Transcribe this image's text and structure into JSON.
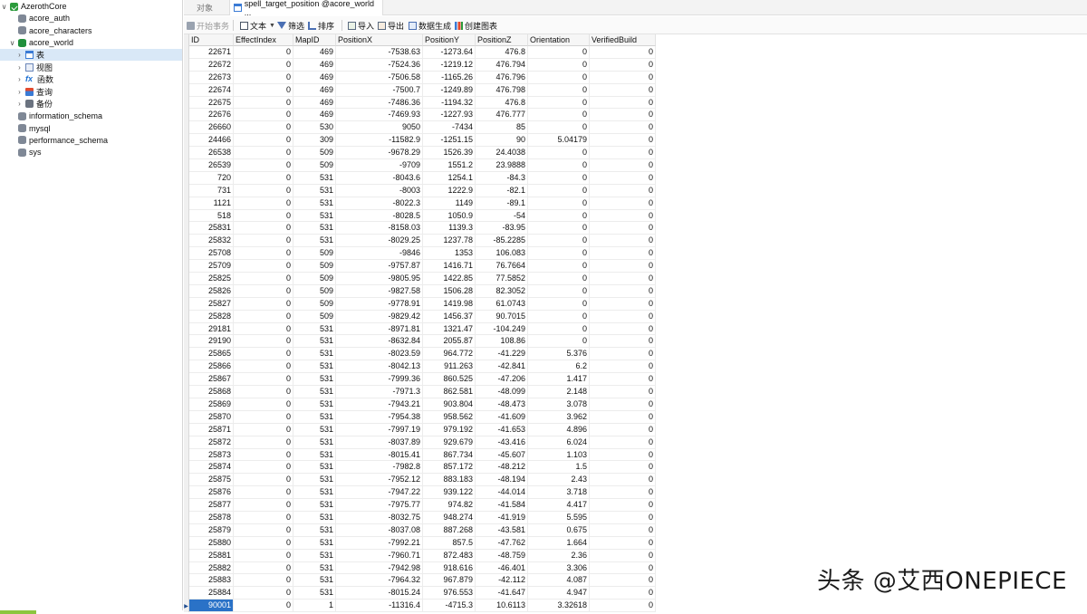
{
  "sidebar": {
    "items": [
      {
        "name": "conn-azerothcore",
        "label": "AzerothCore",
        "icon": "connection-icon",
        "chev": "∨",
        "indent": 0
      },
      {
        "name": "db-acore-auth",
        "label": "acore_auth",
        "icon": "database-icon",
        "chev": "",
        "indent": 1
      },
      {
        "name": "db-acore-characters",
        "label": "acore_characters",
        "icon": "database-icon",
        "chev": "",
        "indent": 1
      },
      {
        "name": "db-acore-world",
        "label": "acore_world",
        "icon": "database-open-icon",
        "chev": "∨",
        "indent": 1
      },
      {
        "name": "node-tables",
        "label": "表",
        "icon": "table-icon",
        "chev": "›",
        "indent": 2,
        "selected": true
      },
      {
        "name": "node-views",
        "label": "视图",
        "icon": "view-icon",
        "chev": "›",
        "indent": 2
      },
      {
        "name": "node-functions",
        "label": "函数",
        "icon": "function-icon",
        "chev": "›",
        "indent": 2
      },
      {
        "name": "node-queries",
        "label": "查询",
        "icon": "query-icon",
        "chev": "›",
        "indent": 2
      },
      {
        "name": "node-backups",
        "label": "备份",
        "icon": "backup-icon",
        "chev": "›",
        "indent": 2
      },
      {
        "name": "db-information-schema",
        "label": "information_schema",
        "icon": "database-icon",
        "chev": "",
        "indent": 1
      },
      {
        "name": "db-mysql",
        "label": "mysql",
        "icon": "database-icon",
        "chev": "",
        "indent": 1
      },
      {
        "name": "db-performance-schema",
        "label": "performance_schema",
        "icon": "database-icon",
        "chev": "",
        "indent": 1
      },
      {
        "name": "db-sys",
        "label": "sys",
        "icon": "database-icon",
        "chev": "",
        "indent": 1
      }
    ]
  },
  "tabs": {
    "objects_label": "对象",
    "active_label": "spell_target_position @acore_world ..."
  },
  "toolbar": {
    "begin_tx": "开始事务",
    "text": "文本",
    "filter": "筛选",
    "sort": "排序",
    "import": "导入",
    "export": "导出",
    "generate": "数据生成",
    "create_chart": "创建图表"
  },
  "table": {
    "columns": [
      "ID",
      "EffectIndex",
      "MapID",
      "PositionX",
      "PositionY",
      "PositionZ",
      "Orientation",
      "VerifiedBuild"
    ],
    "rows": [
      [
        "22671",
        "0",
        "469",
        "-7538.63",
        "-1273.64",
        "476.8",
        "0",
        "0"
      ],
      [
        "22672",
        "0",
        "469",
        "-7524.36",
        "-1219.12",
        "476.794",
        "0",
        "0"
      ],
      [
        "22673",
        "0",
        "469",
        "-7506.58",
        "-1165.26",
        "476.796",
        "0",
        "0"
      ],
      [
        "22674",
        "0",
        "469",
        "-7500.7",
        "-1249.89",
        "476.798",
        "0",
        "0"
      ],
      [
        "22675",
        "0",
        "469",
        "-7486.36",
        "-1194.32",
        "476.8",
        "0",
        "0"
      ],
      [
        "22676",
        "0",
        "469",
        "-7469.93",
        "-1227.93",
        "476.777",
        "0",
        "0"
      ],
      [
        "26660",
        "0",
        "530",
        "9050",
        "-7434",
        "85",
        "0",
        "0"
      ],
      [
        "24466",
        "0",
        "309",
        "-11582.9",
        "-1251.15",
        "90",
        "5.04179",
        "0"
      ],
      [
        "26538",
        "0",
        "509",
        "-9678.29",
        "1526.39",
        "24.4038",
        "0",
        "0"
      ],
      [
        "26539",
        "0",
        "509",
        "-9709",
        "1551.2",
        "23.9888",
        "0",
        "0"
      ],
      [
        "720",
        "0",
        "531",
        "-8043.6",
        "1254.1",
        "-84.3",
        "0",
        "0"
      ],
      [
        "731",
        "0",
        "531",
        "-8003",
        "1222.9",
        "-82.1",
        "0",
        "0"
      ],
      [
        "1121",
        "0",
        "531",
        "-8022.3",
        "1149",
        "-89.1",
        "0",
        "0"
      ],
      [
        "518",
        "0",
        "531",
        "-8028.5",
        "1050.9",
        "-54",
        "0",
        "0"
      ],
      [
        "25831",
        "0",
        "531",
        "-8158.03",
        "1139.3",
        "-83.95",
        "0",
        "0"
      ],
      [
        "25832",
        "0",
        "531",
        "-8029.25",
        "1237.78",
        "-85.2285",
        "0",
        "0"
      ],
      [
        "25708",
        "0",
        "509",
        "-9846",
        "1353",
        "106.083",
        "0",
        "0"
      ],
      [
        "25709",
        "0",
        "509",
        "-9757.87",
        "1416.71",
        "76.7664",
        "0",
        "0"
      ],
      [
        "25825",
        "0",
        "509",
        "-9805.95",
        "1422.85",
        "77.5852",
        "0",
        "0"
      ],
      [
        "25826",
        "0",
        "509",
        "-9827.58",
        "1506.28",
        "82.3052",
        "0",
        "0"
      ],
      [
        "25827",
        "0",
        "509",
        "-9778.91",
        "1419.98",
        "61.0743",
        "0",
        "0"
      ],
      [
        "25828",
        "0",
        "509",
        "-9829.42",
        "1456.37",
        "90.7015",
        "0",
        "0"
      ],
      [
        "29181",
        "0",
        "531",
        "-8971.81",
        "1321.47",
        "-104.249",
        "0",
        "0"
      ],
      [
        "29190",
        "0",
        "531",
        "-8632.84",
        "2055.87",
        "108.86",
        "0",
        "0"
      ],
      [
        "25865",
        "0",
        "531",
        "-8023.59",
        "964.772",
        "-41.229",
        "5.376",
        "0"
      ],
      [
        "25866",
        "0",
        "531",
        "-8042.13",
        "911.263",
        "-42.841",
        "6.2",
        "0"
      ],
      [
        "25867",
        "0",
        "531",
        "-7999.36",
        "860.525",
        "-47.206",
        "1.417",
        "0"
      ],
      [
        "25868",
        "0",
        "531",
        "-7971.3",
        "862.581",
        "-48.099",
        "2.148",
        "0"
      ],
      [
        "25869",
        "0",
        "531",
        "-7943.21",
        "903.804",
        "-48.473",
        "3.078",
        "0"
      ],
      [
        "25870",
        "0",
        "531",
        "-7954.38",
        "958.562",
        "-41.609",
        "3.962",
        "0"
      ],
      [
        "25871",
        "0",
        "531",
        "-7997.19",
        "979.192",
        "-41.653",
        "4.896",
        "0"
      ],
      [
        "25872",
        "0",
        "531",
        "-8037.89",
        "929.679",
        "-43.416",
        "6.024",
        "0"
      ],
      [
        "25873",
        "0",
        "531",
        "-8015.41",
        "867.734",
        "-45.607",
        "1.103",
        "0"
      ],
      [
        "25874",
        "0",
        "531",
        "-7982.8",
        "857.172",
        "-48.212",
        "1.5",
        "0"
      ],
      [
        "25875",
        "0",
        "531",
        "-7952.12",
        "883.183",
        "-48.194",
        "2.43",
        "0"
      ],
      [
        "25876",
        "0",
        "531",
        "-7947.22",
        "939.122",
        "-44.014",
        "3.718",
        "0"
      ],
      [
        "25877",
        "0",
        "531",
        "-7975.77",
        "974.82",
        "-41.584",
        "4.417",
        "0"
      ],
      [
        "25878",
        "0",
        "531",
        "-8032.75",
        "948.274",
        "-41.919",
        "5.595",
        "0"
      ],
      [
        "25879",
        "0",
        "531",
        "-8037.08",
        "887.268",
        "-43.581",
        "0.675",
        "0"
      ],
      [
        "25880",
        "0",
        "531",
        "-7992.21",
        "857.5",
        "-47.762",
        "1.664",
        "0"
      ],
      [
        "25881",
        "0",
        "531",
        "-7960.71",
        "872.483",
        "-48.759",
        "2.36",
        "0"
      ],
      [
        "25882",
        "0",
        "531",
        "-7942.98",
        "918.616",
        "-46.401",
        "3.306",
        "0"
      ],
      [
        "25883",
        "0",
        "531",
        "-7964.32",
        "967.879",
        "-42.112",
        "4.087",
        "0"
      ],
      [
        "25884",
        "0",
        "531",
        "-8015.24",
        "976.553",
        "-41.647",
        "4.947",
        "0"
      ],
      [
        "90001",
        "0",
        "1",
        "-11316.4",
        "-4715.3",
        "10.6113",
        "3.32618",
        "0"
      ]
    ],
    "selected_row_index": 44,
    "current_row_marker": "▶"
  },
  "watermark": "头条 @艾西ONEPIECE",
  "colors": {
    "selection": "#2a72c7",
    "tree_selected": "#d9e8f7",
    "connection_green": "#2c9b3c"
  }
}
